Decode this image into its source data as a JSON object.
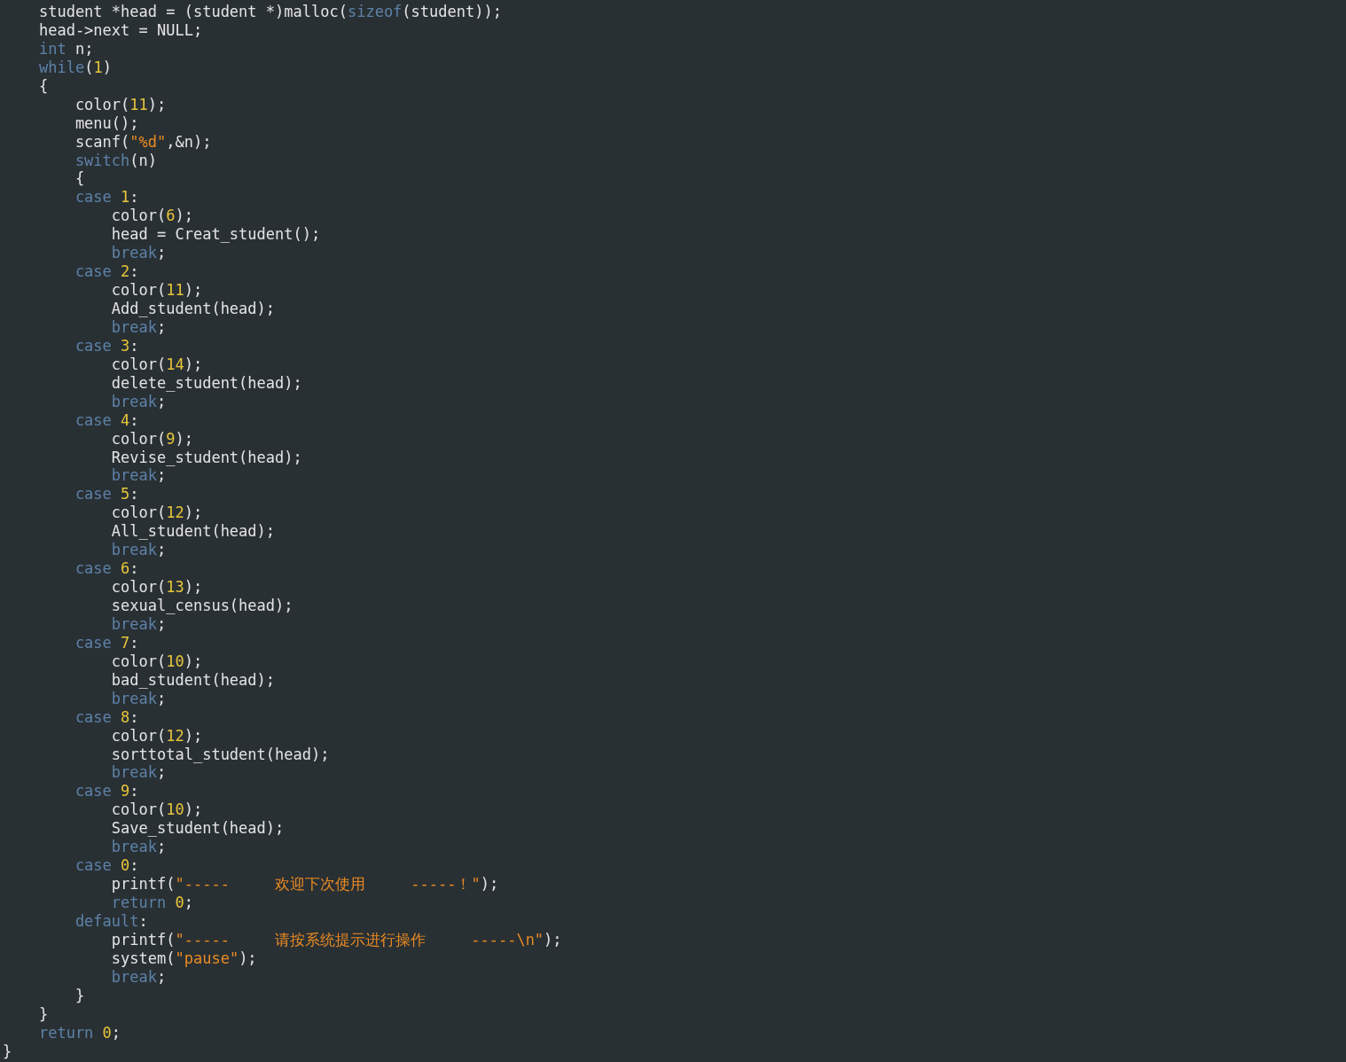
{
  "editor": {
    "lines": [
      [
        {
          "kind": "plain",
          "text": "    student *head = (student *)malloc("
        },
        {
          "kind": "keyword",
          "text": "sizeof"
        },
        {
          "kind": "plain",
          "text": "(student));"
        }
      ],
      [
        {
          "kind": "plain",
          "text": "    head->next = NULL;"
        }
      ],
      [
        {
          "kind": "keyword",
          "text": "    int"
        },
        {
          "kind": "plain",
          "text": " n;"
        }
      ],
      [
        {
          "kind": "keyword",
          "text": "    while"
        },
        {
          "kind": "plain",
          "text": "("
        },
        {
          "kind": "number",
          "text": "1"
        },
        {
          "kind": "plain",
          "text": ")"
        }
      ],
      [
        {
          "kind": "plain",
          "text": "    {"
        }
      ],
      [
        {
          "kind": "plain",
          "text": "        color("
        },
        {
          "kind": "number",
          "text": "11"
        },
        {
          "kind": "plain",
          "text": ");"
        }
      ],
      [
        {
          "kind": "plain",
          "text": "        menu();"
        }
      ],
      [
        {
          "kind": "plain",
          "text": "        scanf("
        },
        {
          "kind": "string",
          "text": "\"%d\""
        },
        {
          "kind": "plain",
          "text": ",&n);"
        }
      ],
      [
        {
          "kind": "keyword",
          "text": "        switch"
        },
        {
          "kind": "plain",
          "text": "(n)"
        }
      ],
      [
        {
          "kind": "plain",
          "text": "        {"
        }
      ],
      [
        {
          "kind": "keyword",
          "text": "        case"
        },
        {
          "kind": "number",
          "text": " 1"
        },
        {
          "kind": "plain",
          "text": ":"
        }
      ],
      [
        {
          "kind": "plain",
          "text": "            color("
        },
        {
          "kind": "number",
          "text": "6"
        },
        {
          "kind": "plain",
          "text": ");"
        }
      ],
      [
        {
          "kind": "plain",
          "text": "            head = Creat_student();"
        }
      ],
      [
        {
          "kind": "keyword",
          "text": "            break"
        },
        {
          "kind": "plain",
          "text": ";"
        }
      ],
      [
        {
          "kind": "keyword",
          "text": "        case"
        },
        {
          "kind": "number",
          "text": " 2"
        },
        {
          "kind": "plain",
          "text": ":"
        }
      ],
      [
        {
          "kind": "plain",
          "text": "            color("
        },
        {
          "kind": "number",
          "text": "11"
        },
        {
          "kind": "plain",
          "text": ");"
        }
      ],
      [
        {
          "kind": "plain",
          "text": "            Add_student(head);"
        }
      ],
      [
        {
          "kind": "keyword",
          "text": "            break"
        },
        {
          "kind": "plain",
          "text": ";"
        }
      ],
      [
        {
          "kind": "keyword",
          "text": "        case"
        },
        {
          "kind": "number",
          "text": " 3"
        },
        {
          "kind": "plain",
          "text": ":"
        }
      ],
      [
        {
          "kind": "plain",
          "text": "            color("
        },
        {
          "kind": "number",
          "text": "14"
        },
        {
          "kind": "plain",
          "text": ");"
        }
      ],
      [
        {
          "kind": "plain",
          "text": "            delete_student(head);"
        }
      ],
      [
        {
          "kind": "keyword",
          "text": "            break"
        },
        {
          "kind": "plain",
          "text": ";"
        }
      ],
      [
        {
          "kind": "keyword",
          "text": "        case"
        },
        {
          "kind": "number",
          "text": " 4"
        },
        {
          "kind": "plain",
          "text": ":"
        }
      ],
      [
        {
          "kind": "plain",
          "text": "            color("
        },
        {
          "kind": "number",
          "text": "9"
        },
        {
          "kind": "plain",
          "text": ");"
        }
      ],
      [
        {
          "kind": "plain",
          "text": "            Revise_student(head);"
        }
      ],
      [
        {
          "kind": "keyword",
          "text": "            break"
        },
        {
          "kind": "plain",
          "text": ";"
        }
      ],
      [
        {
          "kind": "keyword",
          "text": "        case"
        },
        {
          "kind": "number",
          "text": " 5"
        },
        {
          "kind": "plain",
          "text": ":"
        }
      ],
      [
        {
          "kind": "plain",
          "text": "            color("
        },
        {
          "kind": "number",
          "text": "12"
        },
        {
          "kind": "plain",
          "text": ");"
        }
      ],
      [
        {
          "kind": "plain",
          "text": "            All_student(head);"
        }
      ],
      [
        {
          "kind": "keyword",
          "text": "            break"
        },
        {
          "kind": "plain",
          "text": ";"
        }
      ],
      [
        {
          "kind": "keyword",
          "text": "        case"
        },
        {
          "kind": "number",
          "text": " 6"
        },
        {
          "kind": "plain",
          "text": ":"
        }
      ],
      [
        {
          "kind": "plain",
          "text": "            color("
        },
        {
          "kind": "number",
          "text": "13"
        },
        {
          "kind": "plain",
          "text": ");"
        }
      ],
      [
        {
          "kind": "plain",
          "text": "            sexual_census(head);"
        }
      ],
      [
        {
          "kind": "keyword",
          "text": "            break"
        },
        {
          "kind": "plain",
          "text": ";"
        }
      ],
      [
        {
          "kind": "keyword",
          "text": "        case"
        },
        {
          "kind": "number",
          "text": " 7"
        },
        {
          "kind": "plain",
          "text": ":"
        }
      ],
      [
        {
          "kind": "plain",
          "text": "            color("
        },
        {
          "kind": "number",
          "text": "10"
        },
        {
          "kind": "plain",
          "text": ");"
        }
      ],
      [
        {
          "kind": "plain",
          "text": "            bad_student(head);"
        }
      ],
      [
        {
          "kind": "keyword",
          "text": "            break"
        },
        {
          "kind": "plain",
          "text": ";"
        }
      ],
      [
        {
          "kind": "keyword",
          "text": "        case"
        },
        {
          "kind": "number",
          "text": " 8"
        },
        {
          "kind": "plain",
          "text": ":"
        }
      ],
      [
        {
          "kind": "plain",
          "text": "            color("
        },
        {
          "kind": "number",
          "text": "12"
        },
        {
          "kind": "plain",
          "text": ");"
        }
      ],
      [
        {
          "kind": "plain",
          "text": "            sorttotal_student(head);"
        }
      ],
      [
        {
          "kind": "keyword",
          "text": "            break"
        },
        {
          "kind": "plain",
          "text": ";"
        }
      ],
      [
        {
          "kind": "keyword",
          "text": "        case"
        },
        {
          "kind": "number",
          "text": " 9"
        },
        {
          "kind": "plain",
          "text": ":"
        }
      ],
      [
        {
          "kind": "plain",
          "text": "            color("
        },
        {
          "kind": "number",
          "text": "10"
        },
        {
          "kind": "plain",
          "text": ");"
        }
      ],
      [
        {
          "kind": "plain",
          "text": "            Save_student(head);"
        }
      ],
      [
        {
          "kind": "keyword",
          "text": "            break"
        },
        {
          "kind": "plain",
          "text": ";"
        }
      ],
      [
        {
          "kind": "keyword",
          "text": "        case"
        },
        {
          "kind": "number",
          "text": " 0"
        },
        {
          "kind": "plain",
          "text": ":"
        }
      ],
      [
        {
          "kind": "plain",
          "text": "            printf("
        },
        {
          "kind": "string",
          "text": "\"-----     欢迎下次使用     -----！\""
        },
        {
          "kind": "plain",
          "text": ");"
        }
      ],
      [
        {
          "kind": "keyword",
          "text": "            return"
        },
        {
          "kind": "number",
          "text": " 0"
        },
        {
          "kind": "plain",
          "text": ";"
        }
      ],
      [
        {
          "kind": "keyword",
          "text": "        default"
        },
        {
          "kind": "plain",
          "text": ":"
        }
      ],
      [
        {
          "kind": "plain",
          "text": "            printf("
        },
        {
          "kind": "string",
          "text": "\"-----     请按系统提示进行操作     -----\\n\""
        },
        {
          "kind": "plain",
          "text": ");"
        }
      ],
      [
        {
          "kind": "plain",
          "text": "            system("
        },
        {
          "kind": "string",
          "text": "\"pause\""
        },
        {
          "kind": "plain",
          "text": ");"
        }
      ],
      [
        {
          "kind": "keyword",
          "text": "            break"
        },
        {
          "kind": "plain",
          "text": ";"
        }
      ],
      [
        {
          "kind": "plain",
          "text": "        }"
        }
      ],
      [
        {
          "kind": "plain",
          "text": "    }"
        }
      ],
      [
        {
          "kind": "keyword",
          "text": "    return"
        },
        {
          "kind": "number",
          "text": " 0"
        },
        {
          "kind": "plain",
          "text": ";"
        }
      ],
      [
        {
          "kind": "plain",
          "text": "}"
        }
      ]
    ]
  }
}
